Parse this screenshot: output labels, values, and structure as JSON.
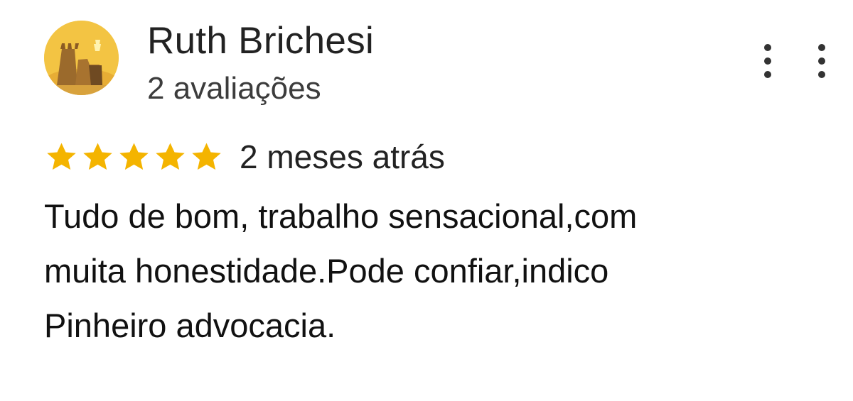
{
  "reviewer": {
    "name": "Ruth Brichesi",
    "reviews_count_label": "2 avaliações",
    "avatar_icon": "castle-avatar-icon"
  },
  "menu": {
    "icon": "more-vert-icon"
  },
  "review": {
    "rating": 5,
    "rating_max": 5,
    "star_color": "#f4b400",
    "date_label": "2 meses atrás",
    "text_lines": [
      "Tudo de bom, trabalho sensacional,com",
      "muita honestidade.Pode confiar,indico",
      "Pinheiro advocacia."
    ]
  },
  "colors": {
    "avatar_background": "#f3c443",
    "avatar_figure": "#9b6a2c",
    "text": "#1f1f1f"
  }
}
